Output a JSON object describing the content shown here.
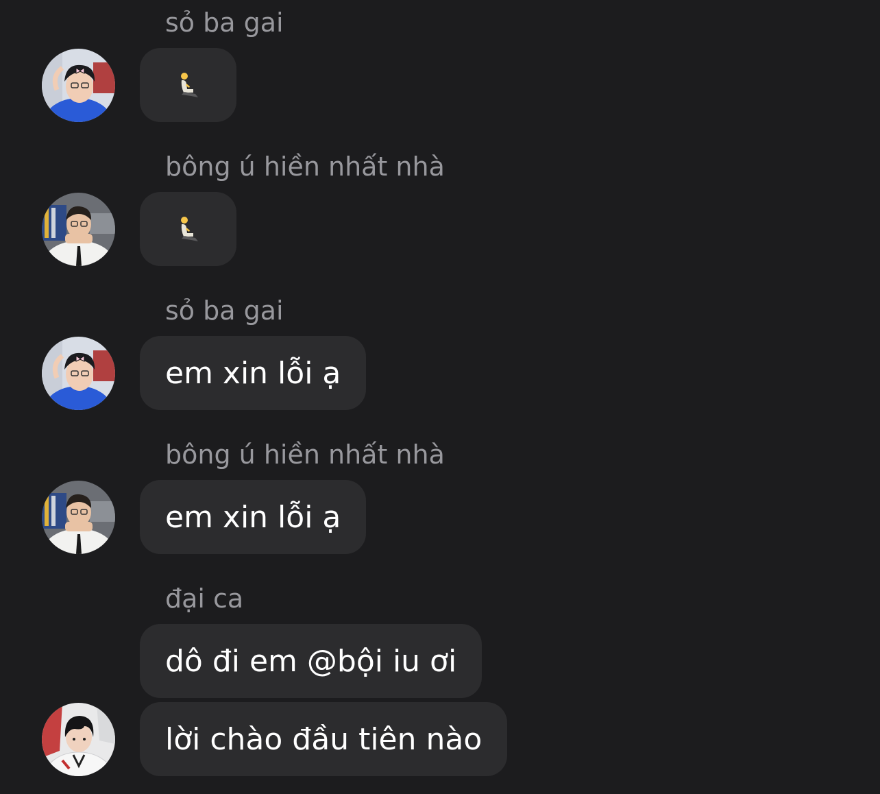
{
  "messages": [
    {
      "sender": "sỏ ba gai",
      "text": "",
      "emoji_icon": "kneeling-person-emoji",
      "avatar": "user-blue-shirt"
    },
    {
      "sender": "bông ú hiền nhất nhà",
      "text": "",
      "emoji_icon": "kneeling-person-emoji",
      "avatar": "user-white-shirt"
    },
    {
      "sender": "sỏ ba gai",
      "text": "em xin lỗi ạ",
      "avatar": "user-blue-shirt"
    },
    {
      "sender": "bông ú hiền nhất nhà",
      "text": "em xin lỗi ạ",
      "avatar": "user-white-shirt"
    },
    {
      "sender": "đại ca",
      "text": "dô đi em @bội iu ơi",
      "avatar": ""
    },
    {
      "sender": "",
      "text": "lời chào đầu tiên nào",
      "avatar": "user-white-jacket"
    }
  ],
  "colors": {
    "background": "#1c1c1e",
    "bubble": "#2c2c2e",
    "sender_text": "#98989d",
    "message_text": "#ffffff"
  }
}
